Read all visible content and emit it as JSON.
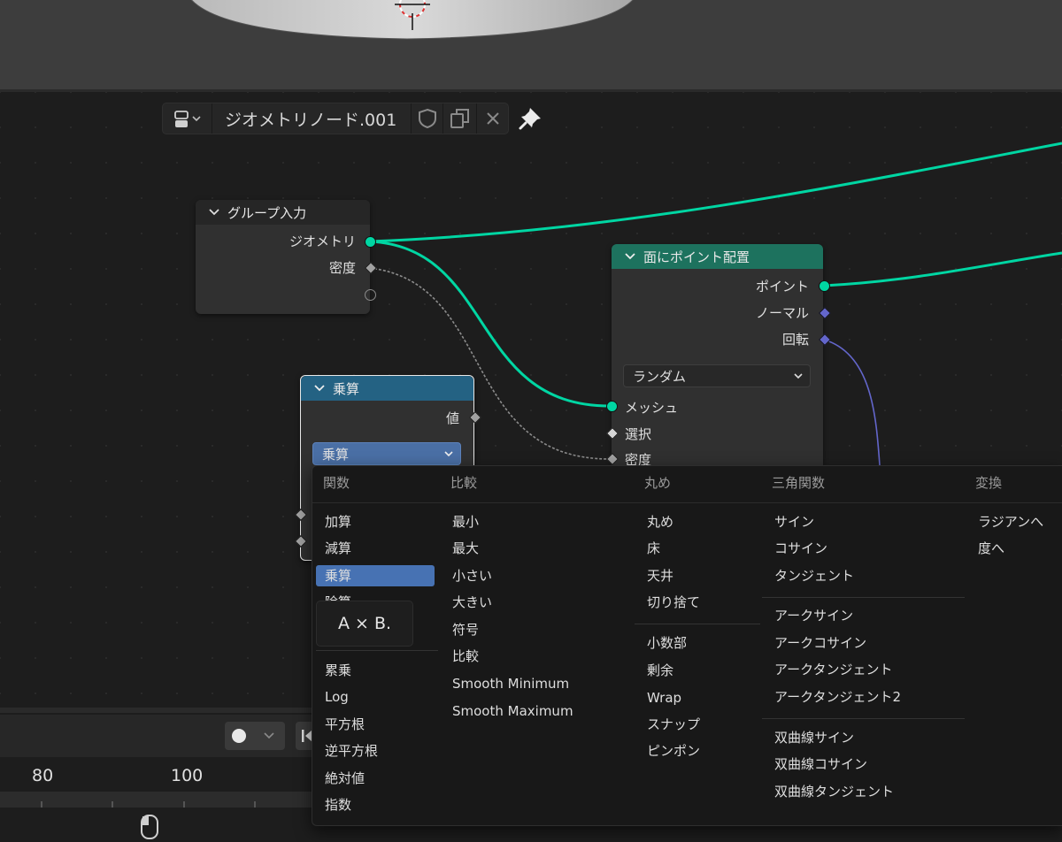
{
  "header": {
    "datablock_name": "ジオメトリノード.001",
    "icons": [
      "node-editor-type-icon",
      "chevron-down-icon",
      "fake-user-shield-icon",
      "duplicate-icon",
      "close-icon",
      "pin-icon"
    ]
  },
  "group_input_node": {
    "title": "グループ入力",
    "outputs": [
      "ジオメトリ",
      "密度"
    ]
  },
  "distribute_node": {
    "title": "面にポイント配置",
    "outputs": [
      "ポイント",
      "ノーマル",
      "回転"
    ],
    "mode": "ランダム",
    "inputs": [
      "メッシュ",
      "選択",
      "密度"
    ]
  },
  "math_node": {
    "title": "乗算",
    "output": "値",
    "operation": "乗算"
  },
  "timeline": {
    "frames": [
      "80",
      "100"
    ]
  },
  "menu": {
    "columns": [
      {
        "header": "関数",
        "groups": [
          [
            "加算",
            "減算",
            "乗算",
            "除算"
          ],
          [
            "累乗",
            "Log",
            "平方根",
            "逆平方根",
            "絶対値",
            "指数"
          ]
        ]
      },
      {
        "header": "比較",
        "groups": [
          [
            "最小",
            "最大",
            "小さい",
            "大きい",
            "符号",
            "比較",
            "Smooth Minimum",
            "Smooth Maximum"
          ]
        ]
      },
      {
        "header": "丸め",
        "groups": [
          [
            "丸め",
            "床",
            "天井",
            "切り捨て"
          ],
          [
            "小数部",
            "剰余",
            "Wrap",
            "スナップ",
            "ピンポン"
          ]
        ]
      },
      {
        "header": "三角関数",
        "groups": [
          [
            "サイン",
            "コサイン",
            "タンジェント"
          ],
          [
            "アークサイン",
            "アークコサイン",
            "アークタンジェント",
            "アークタンジェント2"
          ],
          [
            "双曲線サイン",
            "双曲線コサイン",
            "双曲線タンジェント"
          ]
        ]
      },
      {
        "header": "変換",
        "groups": [
          [
            "ラジアンへ",
            "度へ"
          ]
        ]
      }
    ],
    "selected": "乗算",
    "tooltip": "A × B."
  },
  "colors": {
    "geometry_socket": "#00d6a3",
    "vector_socket": "#6366cb",
    "float_socket": "#a1a1a1",
    "distribute_header": "#1d725e",
    "math_header": "#246283",
    "selection_highlight": "#4772b3"
  }
}
